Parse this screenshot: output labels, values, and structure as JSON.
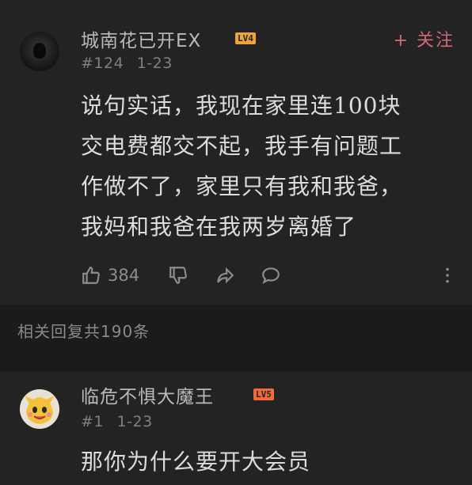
{
  "comment": {
    "username": "城南花已开EX",
    "level": "LV4",
    "floor": "#124",
    "date": "1-23",
    "follow_label": "+ 关注",
    "lines": [
      "说句实话，我现在家里连100块",
      "交电费都交不起，我手有问题工",
      "作做不了，家里只有我和我爸，",
      "我妈和我爸在我两岁离婚了"
    ],
    "like_count": "384",
    "icons": [
      "thumb-up-icon",
      "thumb-down-icon",
      "share-icon",
      "comment-icon",
      "more-icon"
    ]
  },
  "replies": {
    "count_label": "相关回复共190条"
  },
  "reply": {
    "username": "临危不惧大魔王",
    "level": "LV5",
    "floor": "#1",
    "date": "1-23",
    "text": "那你为什么要开大会员"
  },
  "colors": {
    "background": "#1b1b1b",
    "card": "#232323",
    "follow_accent": "#d2687a",
    "lv4_badge": "#f0a33a",
    "lv5_badge": "#f06a3a"
  }
}
